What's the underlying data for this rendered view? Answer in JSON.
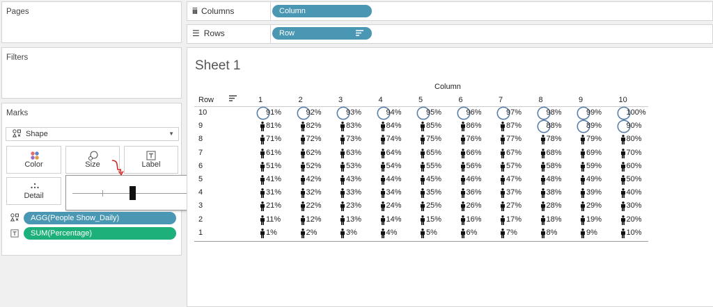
{
  "left_panel": {
    "pages_label": "Pages",
    "filters_label": "Filters",
    "marks_label": "Marks",
    "mark_type": "Shape",
    "buttons": {
      "color": "Color",
      "size": "Size",
      "label": "Label",
      "detail": "Detail"
    },
    "fields": [
      {
        "name": "AGG(People Show_Daily)",
        "color": "#4a97b3",
        "icon": "shape-icon"
      },
      {
        "name": "SUM(Percentage)",
        "color": "#1db07a",
        "icon": "text-label-icon"
      }
    ],
    "size_slider_level": 0.5
  },
  "shelves": {
    "columns_label": "Columns",
    "columns_pill": "Column",
    "rows_label": "Rows",
    "rows_pill": "Row"
  },
  "sheet": {
    "title": "Sheet 1",
    "column_header": "Column",
    "row_header": "Row",
    "columns": [
      "1",
      "2",
      "3",
      "4",
      "5",
      "6",
      "7",
      "8",
      "9",
      "10"
    ],
    "rows": [
      "10",
      "9",
      "8",
      "7",
      "6",
      "5",
      "4",
      "3",
      "2",
      "1"
    ],
    "cells": [
      [
        "91%",
        "92%",
        "93%",
        "94%",
        "95%",
        "96%",
        "97%",
        "98%",
        "99%",
        "100%"
      ],
      [
        "81%",
        "82%",
        "83%",
        "84%",
        "85%",
        "86%",
        "87%",
        "88%",
        "89%",
        "90%"
      ],
      [
        "71%",
        "72%",
        "73%",
        "74%",
        "75%",
        "76%",
        "77%",
        "78%",
        "79%",
        "80%"
      ],
      [
        "61%",
        "62%",
        "63%",
        "64%",
        "65%",
        "66%",
        "67%",
        "68%",
        "69%",
        "70%"
      ],
      [
        "51%",
        "52%",
        "53%",
        "54%",
        "55%",
        "56%",
        "57%",
        "58%",
        "59%",
        "60%"
      ],
      [
        "41%",
        "42%",
        "43%",
        "44%",
        "45%",
        "46%",
        "47%",
        "48%",
        "49%",
        "50%"
      ],
      [
        "31%",
        "32%",
        "33%",
        "34%",
        "35%",
        "36%",
        "37%",
        "38%",
        "39%",
        "40%"
      ],
      [
        "21%",
        "22%",
        "23%",
        "24%",
        "25%",
        "26%",
        "27%",
        "28%",
        "29%",
        "30%"
      ],
      [
        "11%",
        "12%",
        "13%",
        "14%",
        "15%",
        "16%",
        "17%",
        "18%",
        "19%",
        "20%"
      ],
      [
        "1%",
        "2%",
        "3%",
        "4%",
        "5%",
        "6%",
        "7%",
        "8%",
        "9%",
        "10%"
      ]
    ],
    "shapes": [
      [
        "circle",
        "circle",
        "circle",
        "circle",
        "circle",
        "circle",
        "circle",
        "circle",
        "circle",
        "circle"
      ],
      [
        "person",
        "person",
        "person",
        "person",
        "person",
        "person",
        "person",
        "circle",
        "circle",
        "circle"
      ],
      [
        "person",
        "person",
        "person",
        "person",
        "person",
        "person",
        "person",
        "person",
        "person",
        "person"
      ],
      [
        "person",
        "person",
        "person",
        "person",
        "person",
        "person",
        "person",
        "person",
        "person",
        "person"
      ],
      [
        "person",
        "person",
        "person",
        "person",
        "person",
        "person",
        "person",
        "person",
        "person",
        "person"
      ],
      [
        "person",
        "person",
        "person",
        "person",
        "person",
        "person",
        "person",
        "person",
        "person",
        "person"
      ],
      [
        "person",
        "person",
        "person",
        "person",
        "person",
        "person",
        "person",
        "person",
        "person",
        "person"
      ],
      [
        "person",
        "person",
        "person",
        "person",
        "person",
        "person",
        "person",
        "person",
        "person",
        "person"
      ],
      [
        "person",
        "person",
        "person",
        "person",
        "person",
        "person",
        "person",
        "person",
        "person",
        "person"
      ],
      [
        "person",
        "person",
        "person",
        "person",
        "person",
        "person",
        "person",
        "person",
        "person",
        "person"
      ]
    ]
  },
  "colors": {
    "accent_blue": "#4a97b3",
    "accent_green": "#1db07a",
    "circle_stroke": "#5b7fa8",
    "annotation_red": "#d62020"
  }
}
